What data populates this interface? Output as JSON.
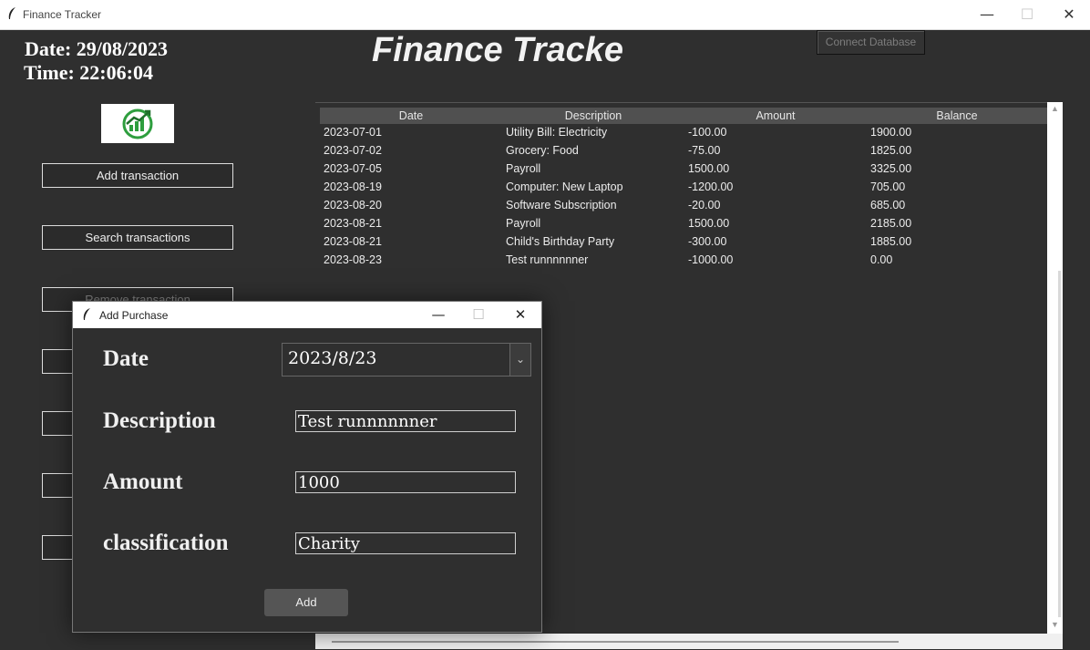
{
  "window": {
    "title": "Finance Tracker"
  },
  "header": {
    "date": "Date: 29/08/2023",
    "time": "Time: 22:06:04",
    "app_title": "Finance Tracke",
    "connect_label": "Connect Database"
  },
  "sidebar": {
    "add_label": "Add transaction",
    "search_label": "Search transactions",
    "remove_label": "Remove transaction"
  },
  "table": {
    "columns": [
      "Date",
      "Description",
      "Amount",
      "Balance"
    ],
    "rows": [
      [
        "2023-07-01",
        "Utility Bill: Electricity",
        "-100.00",
        "1900.00"
      ],
      [
        "2023-07-02",
        "Grocery: Food",
        "-75.00",
        "1825.00"
      ],
      [
        "2023-07-05",
        "Payroll",
        "1500.00",
        "3325.00"
      ],
      [
        "2023-08-19",
        "Computer: New Laptop",
        "-1200.00",
        "705.00"
      ],
      [
        "2023-08-20",
        "Software Subscription",
        "-20.00",
        "685.00"
      ],
      [
        "2023-08-21",
        "Payroll",
        "1500.00",
        "2185.00"
      ],
      [
        "2023-08-21",
        "Child's Birthday Party",
        "-300.00",
        "1885.00"
      ],
      [
        "2023-08-23",
        "Test runnnnnner",
        "-1000.00",
        "0.00"
      ]
    ]
  },
  "dialog": {
    "title": "Add Purchase",
    "date_label": "Date",
    "date_value": "2023/8/23",
    "description_label": "Description",
    "description_value": "Test runnnnnner",
    "amount_label": "Amount",
    "amount_value": "1000",
    "classification_label": "classification",
    "classification_value": "Charity",
    "add_label": "Add"
  }
}
